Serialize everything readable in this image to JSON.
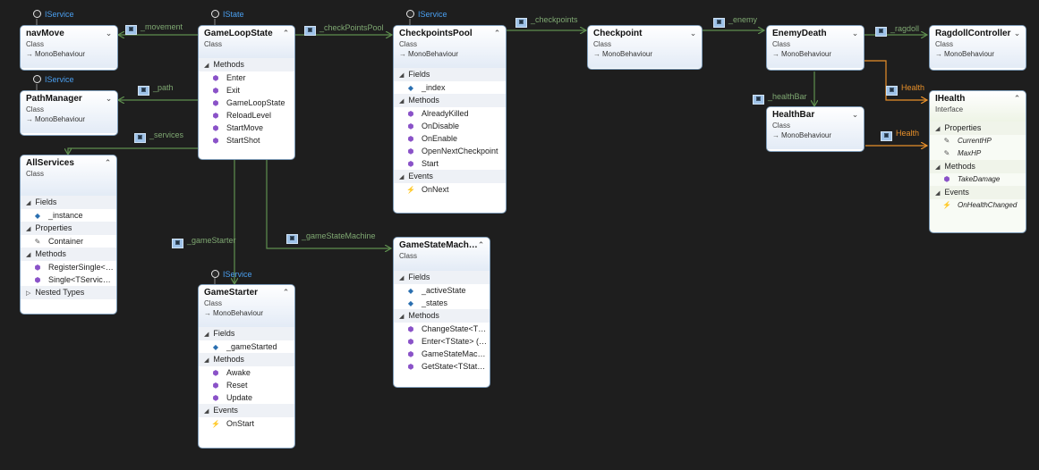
{
  "lollipops": [
    {
      "id": "l-navmove",
      "label": "IService"
    },
    {
      "id": "l-gls",
      "label": "IState"
    },
    {
      "id": "l-cpp",
      "label": "IService"
    },
    {
      "id": "l-pathmgr",
      "label": "IService"
    },
    {
      "id": "l-gamestarter",
      "label": "IService"
    }
  ],
  "assoc_labels": {
    "movement": "_movement",
    "path": "_path",
    "services": "_services",
    "checkPointsPool": "_checkPointsPool",
    "checkpoints": "_checkpoints",
    "enemy": "_enemy",
    "ragdoll": "_ragdoll",
    "healthBar": "_healthBar",
    "health1": "Health",
    "health2": "Health",
    "gameStarter": "_gameStarter",
    "gameStateMachine": "_gameStateMachine"
  },
  "classes": {
    "navMove": {
      "name": "navMove",
      "stereotype": "Class",
      "base": "MonoBehaviour"
    },
    "PathManager": {
      "name": "PathManager",
      "stereotype": "Class",
      "base": "MonoBehaviour"
    },
    "AllServices": {
      "name": "AllServices",
      "stereotype": "Class",
      "fields_label": "Fields",
      "fields": [
        "_instance"
      ],
      "properties_label": "Properties",
      "properties": [
        "Container"
      ],
      "methods_label": "Methods",
      "methods": [
        "RegisterSingle<…",
        "Single<TServic…"
      ],
      "nested_label": "Nested Types"
    },
    "GameLoopState": {
      "name": "GameLoopState",
      "stereotype": "Class",
      "methods_label": "Methods",
      "methods": [
        "Enter",
        "Exit",
        "GameLoopState",
        "ReloadLevel",
        "StartMove",
        "StartShot"
      ]
    },
    "CheckpointsPool": {
      "name": "CheckpointsPool",
      "stereotype": "Class",
      "base": "MonoBehaviour",
      "fields_label": "Fields",
      "fields": [
        "_index"
      ],
      "methods_label": "Methods",
      "methods": [
        "AlreadyKilled",
        "OnDisable",
        "OnEnable",
        "OpenNextCheckpoint",
        "Start"
      ],
      "events_label": "Events",
      "events": [
        "OnNext"
      ]
    },
    "GameStarter": {
      "name": "GameStarter",
      "stereotype": "Class",
      "base": "MonoBehaviour",
      "fields_label": "Fields",
      "fields": [
        "_gameStarted"
      ],
      "methods_label": "Methods",
      "methods": [
        "Awake",
        "Reset",
        "Update"
      ],
      "events_label": "Events",
      "events": [
        "OnStart"
      ]
    },
    "GameStateMachine": {
      "name": "GameStateMach…",
      "stereotype": "Class",
      "fields_label": "Fields",
      "fields": [
        "_activeState",
        "_states"
      ],
      "methods_label": "Methods",
      "methods": [
        "ChangeState<T…",
        "Enter<TState> (…",
        "GameStateMac…",
        "GetState<TStat…"
      ]
    },
    "Checkpoint": {
      "name": "Checkpoint",
      "stereotype": "Class",
      "base": "MonoBehaviour"
    },
    "EnemyDeath": {
      "name": "EnemyDeath",
      "stereotype": "Class",
      "base": "MonoBehaviour"
    },
    "RagdollController": {
      "name": "RagdollController",
      "stereotype": "Class",
      "base": "MonoBehaviour"
    },
    "HealthBar": {
      "name": "HealthBar",
      "stereotype": "Class",
      "base": "MonoBehaviour"
    },
    "IHealth": {
      "name": "IHealth",
      "stereotype": "Interface",
      "properties_label": "Properties",
      "properties": [
        "CurrentHP",
        "MaxHP"
      ],
      "methods_label": "Methods",
      "methods": [
        "TakeDamage"
      ],
      "events_label": "Events",
      "events": [
        "OnHealthChanged"
      ]
    }
  },
  "colors": {
    "background": "#1e1e1e",
    "association": "#5f8f4f",
    "realization": "#e8902a",
    "lollipop_text": "#4a9ff0"
  }
}
